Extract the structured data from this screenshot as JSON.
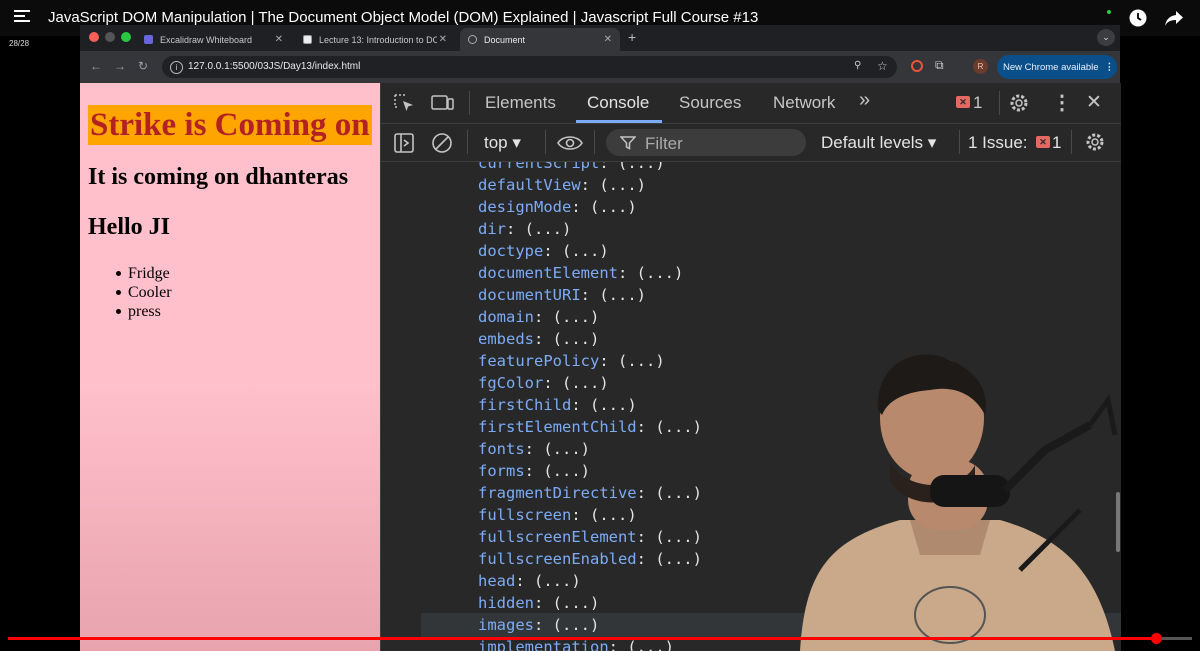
{
  "youtube": {
    "video_title": "JavaScript DOM Manipulation | The Document Object Model (DOM) Explained | Javascript Full Course #13",
    "playlist_counter": "28/28",
    "progress_fraction": 0.97
  },
  "browser": {
    "tabs": [
      {
        "label": "Excalidraw Whiteboard",
        "icon": "excalidraw-icon",
        "active": false
      },
      {
        "label": "Lecture 13: Introduction to DO",
        "icon": "notion-icon",
        "active": false
      },
      {
        "label": "Document",
        "icon": "globe-icon",
        "active": true
      }
    ],
    "new_tab_glyph": "+",
    "url": "127.0.0.1:5500/03JS/Day13/index.html",
    "profile_initial": "R",
    "update_label": "New Chrome available"
  },
  "page": {
    "heading1": "Strike is Coming on",
    "heading2": "It is coming on dhanteras",
    "heading3": "Hello JI",
    "list_items": [
      "Fridge",
      "Cooler",
      "press"
    ],
    "colors": {
      "background": "#ffc0cb",
      "h1_bg": "#ffa500",
      "h1_text": "#b22222"
    }
  },
  "devtools": {
    "tabs": [
      "Elements",
      "Console",
      "Sources",
      "Network"
    ],
    "active_tab": "Console",
    "more_tabs_glyph": "»",
    "error_count": "1",
    "context": "top",
    "filter_placeholder": "Filter",
    "levels": "Default levels",
    "issues": "1 Issue:",
    "issues_count": "1",
    "properties": [
      {
        "key": "currentScript",
        "val": "(...)"
      },
      {
        "key": "defaultView",
        "val": "(...)"
      },
      {
        "key": "designMode",
        "val": "(...)"
      },
      {
        "key": "dir",
        "val": "(...)"
      },
      {
        "key": "doctype",
        "val": "(...)"
      },
      {
        "key": "documentElement",
        "val": "(...)"
      },
      {
        "key": "documentURI",
        "val": "(...)"
      },
      {
        "key": "domain",
        "val": "(...)"
      },
      {
        "key": "embeds",
        "val": "(...)"
      },
      {
        "key": "featurePolicy",
        "val": "(...)"
      },
      {
        "key": "fgColor",
        "val": "(...)"
      },
      {
        "key": "firstChild",
        "val": "(...)"
      },
      {
        "key": "firstElementChild",
        "val": "(...)"
      },
      {
        "key": "fonts",
        "val": "(...)"
      },
      {
        "key": "forms",
        "val": "(...)"
      },
      {
        "key": "fragmentDirective",
        "val": "(...)"
      },
      {
        "key": "fullscreen",
        "val": "(...)"
      },
      {
        "key": "fullscreenElement",
        "val": "(...)"
      },
      {
        "key": "fullscreenEnabled",
        "val": "(...)"
      },
      {
        "key": "head",
        "val": "(...)"
      },
      {
        "key": "hidden",
        "val": "(...)"
      },
      {
        "key": "images",
        "val": "(...)"
      },
      {
        "key": "implementation",
        "val": "(...)"
      }
    ],
    "colors": {
      "key": "#7cacf8",
      "value": "#e3e3e3",
      "accent": "#7cacf8",
      "error": "#e46962"
    }
  }
}
